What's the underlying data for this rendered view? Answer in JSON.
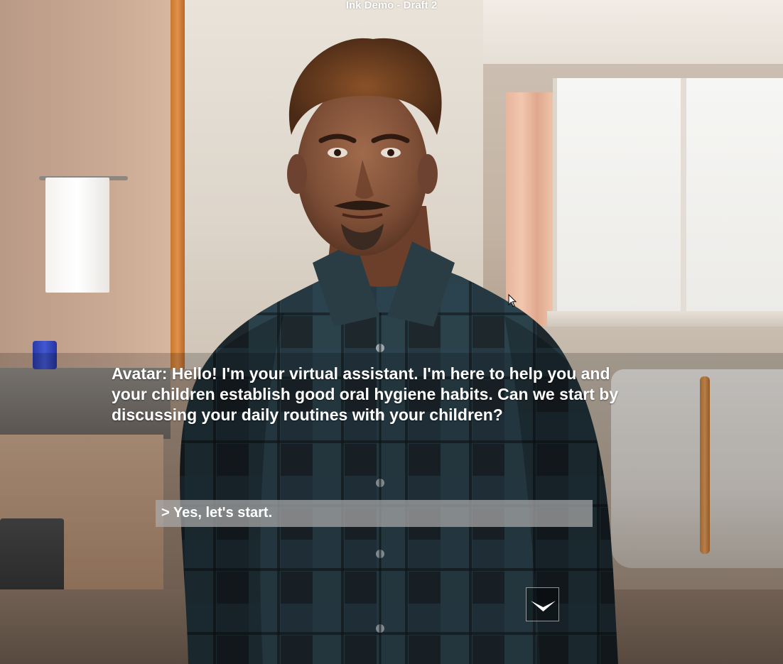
{
  "window": {
    "title": "Ink Demo - Draft 2"
  },
  "dialog": {
    "line": "Avatar: Hello! I'm your virtual assistant. I'm here to help you and your children establish good oral hygiene habits. Can we start by discussing your daily routines with your children?"
  },
  "choices": [
    {
      "label": "> Yes, let's start."
    }
  ],
  "controls": {
    "continue_icon": "chevron-down-icon"
  },
  "colors": {
    "dialog_text": "#ffffff",
    "choice_background": "#aaaaaa",
    "shirt_dark": "#1f2a2f",
    "shirt_blue": "#35535f"
  }
}
